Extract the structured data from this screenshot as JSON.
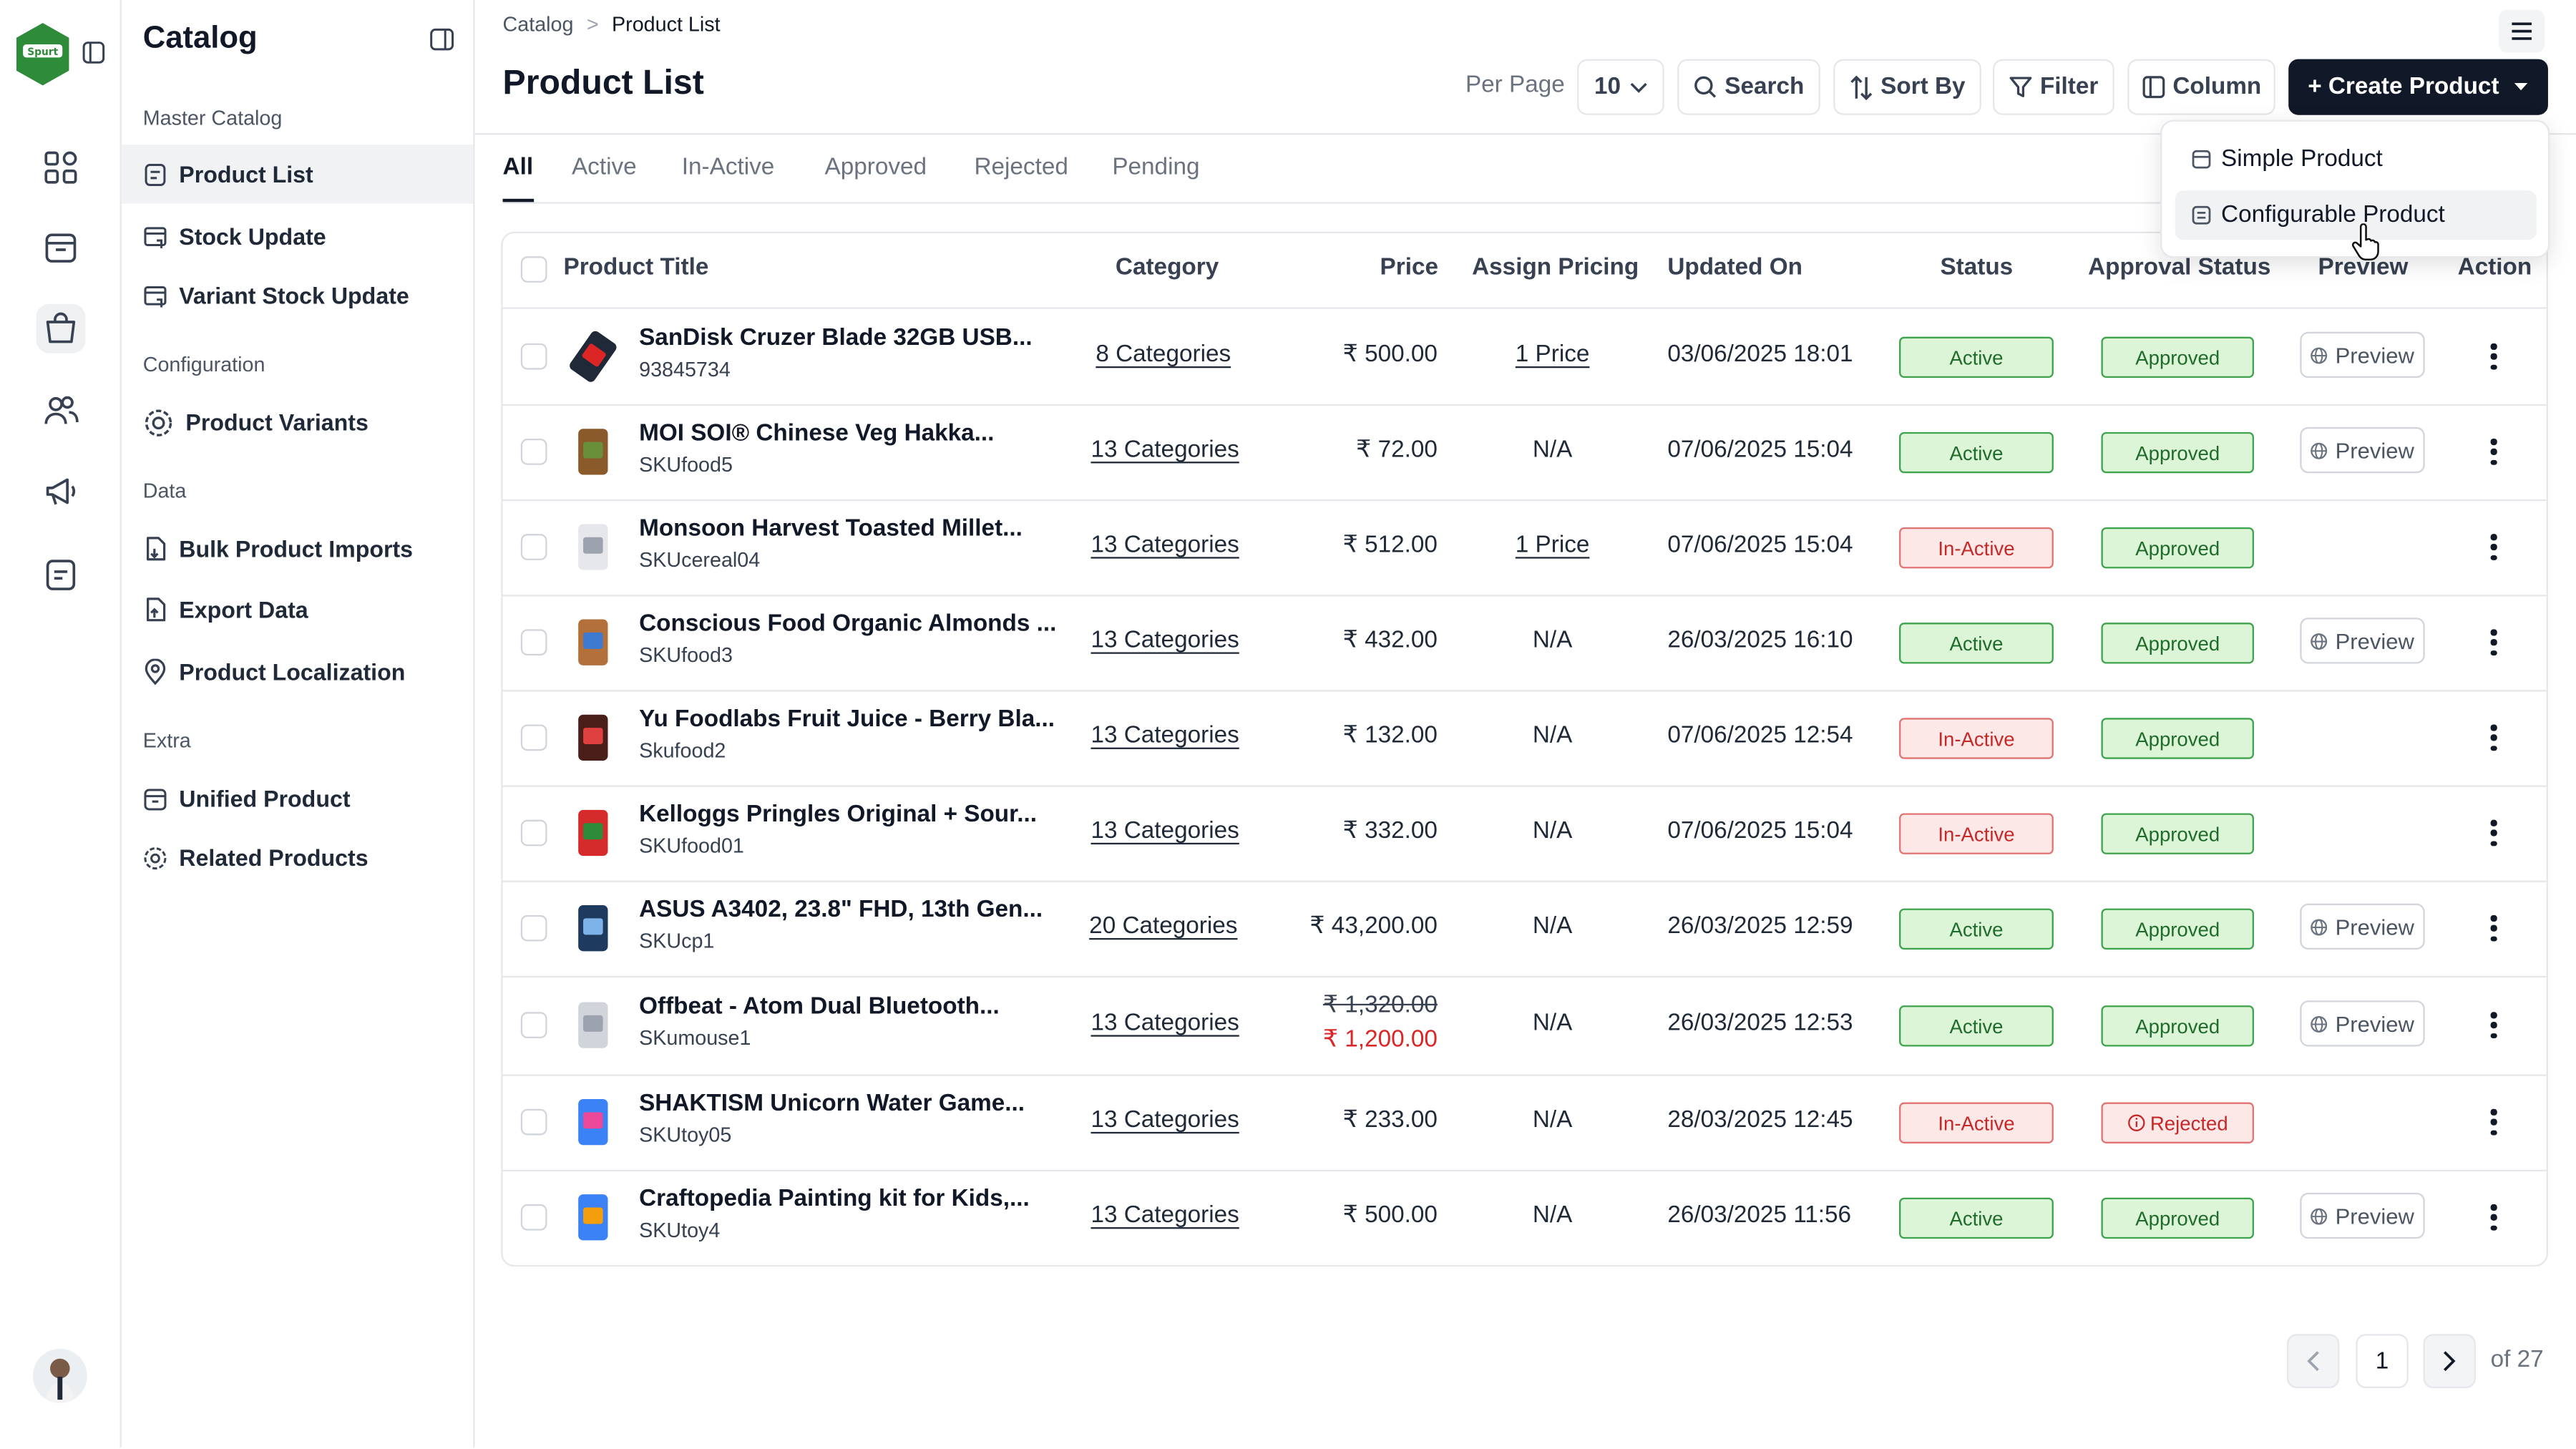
{
  "sidebar": {
    "title": "Catalog",
    "sections": [
      {
        "label": "Master Catalog"
      },
      {
        "label": "Configuration"
      },
      {
        "label": "Data"
      },
      {
        "label": "Extra"
      }
    ],
    "items": [
      {
        "label": "Product List"
      },
      {
        "label": "Stock Update"
      },
      {
        "label": "Variant Stock Update"
      },
      {
        "label": "Product Variants"
      },
      {
        "label": "Bulk Product Imports"
      },
      {
        "label": "Export Data"
      },
      {
        "label": "Product Localization"
      },
      {
        "label": "Unified Product"
      },
      {
        "label": "Related Products"
      }
    ]
  },
  "breadcrumb": {
    "root": "Catalog",
    "separator": ">",
    "current": "Product List"
  },
  "page_title": "Product List",
  "toolbar": {
    "per_page_label": "Per Page",
    "per_page_value": "10",
    "search": "Search",
    "sort": "Sort By",
    "filter": "Filter",
    "column": "Column",
    "create": "+ Create Product"
  },
  "dropdown": {
    "items": [
      {
        "label": "Simple Product"
      },
      {
        "label": "Configurable Product"
      }
    ]
  },
  "tabs": [
    {
      "label": "All"
    },
    {
      "label": "Active"
    },
    {
      "label": "In-Active"
    },
    {
      "label": "Approved"
    },
    {
      "label": "Rejected"
    },
    {
      "label": "Pending"
    }
  ],
  "table": {
    "headers": {
      "title": "Product Title",
      "category": "Category",
      "price": "Price",
      "assign": "Assign Pricing",
      "updated": "Updated On",
      "status": "Status",
      "approval": "Approval Status",
      "preview": "Preview",
      "action": "Action"
    },
    "preview_label": "Preview",
    "rows": [
      {
        "title": "SanDisk Cruzer Blade 32GB USB...",
        "sku": "93845734",
        "category": "8 Categories",
        "price": "₹ 500.00",
        "assign": "1 Price",
        "updated": "03/06/2025 18:01",
        "status": "Active",
        "approval": "Approved"
      },
      {
        "title": "MOI SOI® Chinese Veg Hakka...",
        "sku": "SKUfood5",
        "category": "13 Categories",
        "price": "₹ 72.00",
        "assign": "N/A",
        "updated": "07/06/2025 15:04",
        "status": "Active",
        "approval": "Approved"
      },
      {
        "title": "Monsoon Harvest Toasted Millet...",
        "sku": "SKUcereal04",
        "category": "13 Categories",
        "price": "₹ 512.00",
        "assign": "1 Price",
        "updated": "07/06/2025 15:04",
        "status": "In-Active",
        "approval": "Approved"
      },
      {
        "title": "Conscious Food Organic Almonds ...",
        "sku": "SKUfood3",
        "category": "13 Categories",
        "price": "₹ 432.00",
        "assign": "N/A",
        "updated": "26/03/2025 16:10",
        "status": "Active",
        "approval": "Approved"
      },
      {
        "title": "Yu Foodlabs Fruit Juice - Berry Bla...",
        "sku": "Skufood2",
        "category": "13 Categories",
        "price": "₹ 132.00",
        "assign": "N/A",
        "updated": "07/06/2025 12:54",
        "status": "In-Active",
        "approval": "Approved"
      },
      {
        "title": "Kelloggs Pringles Original + Sour...",
        "sku": "SKUfood01",
        "category": "13 Categories",
        "price": "₹ 332.00",
        "assign": "N/A",
        "updated": "07/06/2025 15:04",
        "status": "In-Active",
        "approval": "Approved"
      },
      {
        "title": "ASUS A3402, 23.8\" FHD, 13th Gen...",
        "sku": "SKUcp1",
        "category": "20 Categories",
        "price": "₹ 43,200.00",
        "assign": "N/A",
        "updated": "26/03/2025 12:59",
        "status": "Active",
        "approval": "Approved"
      },
      {
        "title": "Offbeat - Atom Dual Bluetooth...",
        "sku": "SKumouse1",
        "category": "13 Categories",
        "price_old": "₹ 1,320.00",
        "price": "₹ 1,200.00",
        "assign": "N/A",
        "updated": "26/03/2025 12:53",
        "status": "Active",
        "approval": "Approved"
      },
      {
        "title": "SHAKTISM Unicorn Water Game...",
        "sku": "SKUtoy05",
        "category": "13 Categories",
        "price": "₹ 233.00",
        "assign": "N/A",
        "updated": "28/03/2025 12:45",
        "status": "In-Active",
        "approval": "Rejected"
      },
      {
        "title": "Craftopedia Painting kit for Kids,...",
        "sku": "SKUtoy4",
        "category": "13 Categories",
        "price": "₹ 500.00",
        "assign": "N/A",
        "updated": "26/03/2025 11:56",
        "status": "Active",
        "approval": "Approved"
      }
    ]
  },
  "pagination": {
    "current": "1",
    "of": "of 27"
  },
  "colors": {
    "accent": "#111827",
    "active_bg": "#dcf5d6",
    "inactive_bg": "#fde8e8",
    "logo_green": "#2e8b3a"
  }
}
